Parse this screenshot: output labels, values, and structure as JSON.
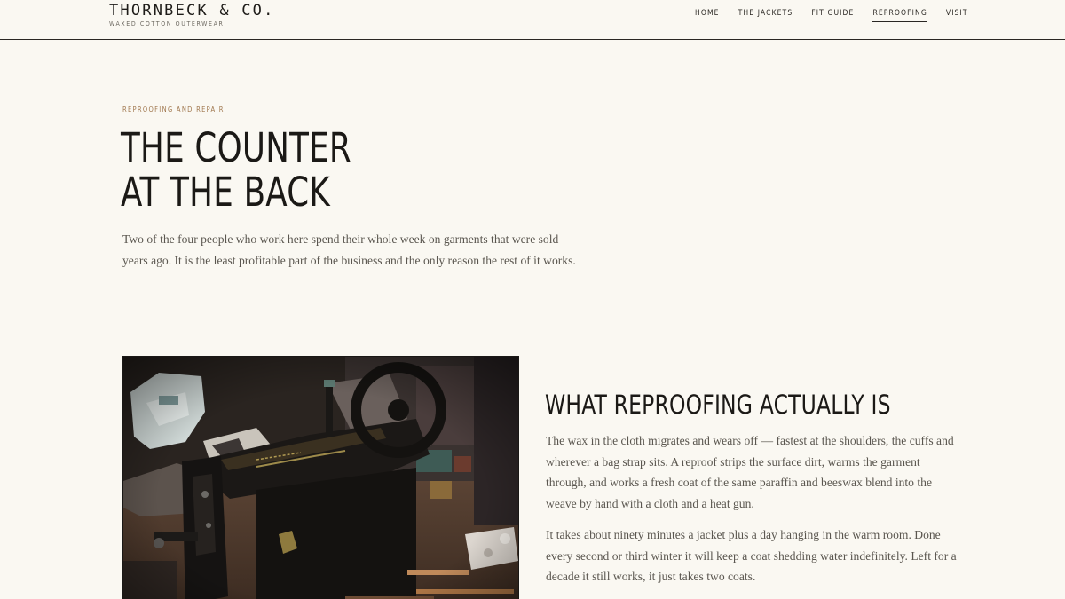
{
  "header": {
    "brand": "THORNBECK & CO.",
    "tagline": "WAXED COTTON OUTERWEAR",
    "nav": [
      {
        "label": "HOME",
        "active": false
      },
      {
        "label": "THE JACKETS",
        "active": false
      },
      {
        "label": "FIT GUIDE",
        "active": false
      },
      {
        "label": "REPROOFING",
        "active": true
      },
      {
        "label": "VISIT",
        "active": false
      }
    ]
  },
  "hero": {
    "eyebrow": "REPROOFING AND REPAIR",
    "title_line1": "THE COUNTER",
    "title_line2": "AT THE BACK",
    "lede": "Two of the four people who work here spend their whole week on garments that were sold years ago. It is the least profitable part of the business and the only reason the rest of it works."
  },
  "article": {
    "heading": "WHAT REPROOFING ACTUALLY IS",
    "paragraphs": [
      "The wax in the cloth migrates and wears off — fastest at the shoulders, the cuffs and wherever a bag strap sits. A reproof strips the surface dirt, warms the garment through, and works a fresh coat of the same paraffin and beeswax blend into the weave by hand with a cloth and a heat gun.",
      "It takes about ninety minutes a jacket plus a day hanging in the warm room. Done every second or third winter it will keep a coat shedding water indefinitely. Left for a decade it still works, it just takes two coats."
    ]
  },
  "colors": {
    "background": "#faf8f2",
    "accent_eyebrow": "#a0774e",
    "text_dark": "#1b1916",
    "text_body": "#5a564f"
  }
}
